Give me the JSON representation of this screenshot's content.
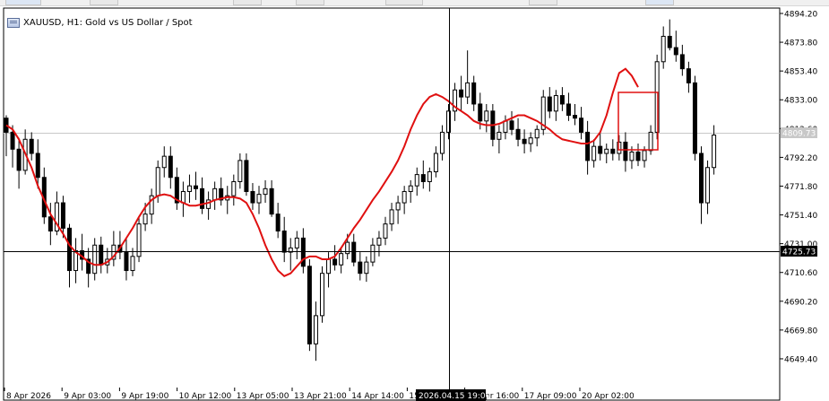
{
  "chart": {
    "symbol_title": "XAUUSD, H1:  Gold vs US Dollar / Spot",
    "bid_price_label": "4809.73",
    "crosshair_price_label": "4725.73",
    "crosshair_time_label": "2026.04.15 19:00",
    "price_axis_labels": [
      "4894.20",
      "4873.80",
      "4853.40",
      "4833.00",
      "4812.60",
      "4792.20",
      "4771.80",
      "4751.40",
      "4731.00",
      "4710.60",
      "4690.20",
      "4669.80",
      "4649.40"
    ],
    "time_axis_labels": [
      "8 Apr 2026",
      "9 Apr 03:00",
      "9 Apr 19:00",
      "10 Apr 12:00",
      "13 Apr 05:00",
      "13 Apr 21:00",
      "14 Apr 14:00",
      "15 Apr 23:00",
      "16 Apr 16:00",
      "17 Apr 09:00",
      "20 Apr 02:00"
    ],
    "colors": {
      "candle": "#000000",
      "ma": "#e01010",
      "grid": "#000000",
      "label_bg": "#000000"
    }
  },
  "chart_data": {
    "type": "candlestick",
    "symbol": "XAUUSD",
    "timeframe": "H1",
    "ylim": [
      4640,
      4900
    ],
    "candles": [
      [
        4820,
        4822,
        4793,
        4810
      ],
      [
        4810,
        4815,
        4785,
        4798
      ],
      [
        4798,
        4806,
        4770,
        4783
      ],
      [
        4783,
        4812,
        4780,
        4805
      ],
      [
        4805,
        4810,
        4790,
        4795
      ],
      [
        4795,
        4805,
        4770,
        4778
      ],
      [
        4778,
        4785,
        4745,
        4750
      ],
      [
        4750,
        4760,
        4730,
        4740
      ],
      [
        4740,
        4768,
        4737,
        4760
      ],
      [
        4760,
        4765,
        4735,
        4742
      ],
      [
        4742,
        4745,
        4700,
        4712
      ],
      [
        4712,
        4735,
        4703,
        4726
      ],
      [
        4726,
        4738,
        4712,
        4720
      ],
      [
        4720,
        4728,
        4700,
        4710
      ],
      [
        4710,
        4735,
        4705,
        4730
      ],
      [
        4730,
        4736,
        4710,
        4716
      ],
      [
        4716,
        4728,
        4710,
        4720
      ],
      [
        4720,
        4740,
        4715,
        4730
      ],
      [
        4730,
        4740,
        4720,
        4725
      ],
      [
        4725,
        4735,
        4705,
        4712
      ],
      [
        4712,
        4728,
        4708,
        4722
      ],
      [
        4722,
        4750,
        4718,
        4745
      ],
      [
        4745,
        4760,
        4740,
        4752
      ],
      [
        4752,
        4770,
        4745,
        4765
      ],
      [
        4765,
        4790,
        4760,
        4785
      ],
      [
        4785,
        4800,
        4778,
        4793
      ],
      [
        4793,
        4800,
        4770,
        4778
      ],
      [
        4778,
        4785,
        4755,
        4760
      ],
      [
        4760,
        4775,
        4750,
        4768
      ],
      [
        4768,
        4780,
        4760,
        4772
      ],
      [
        4772,
        4782,
        4762,
        4770
      ],
      [
        4770,
        4778,
        4752,
        4756
      ],
      [
        4756,
        4768,
        4748,
        4762
      ],
      [
        4762,
        4775,
        4755,
        4770
      ],
      [
        4770,
        4778,
        4758,
        4762
      ],
      [
        4762,
        4772,
        4752,
        4765
      ],
      [
        4765,
        4780,
        4758,
        4775
      ],
      [
        4775,
        4795,
        4770,
        4790
      ],
      [
        4790,
        4795,
        4765,
        4768
      ],
      [
        4768,
        4774,
        4755,
        4760
      ],
      [
        4760,
        4772,
        4752,
        4766
      ],
      [
        4766,
        4776,
        4760,
        4770
      ],
      [
        4770,
        4776,
        4750,
        4752
      ],
      [
        4752,
        4760,
        4735,
        4740
      ],
      [
        4740,
        4750,
        4718,
        4725
      ],
      [
        4725,
        4735,
        4712,
        4728
      ],
      [
        4728,
        4740,
        4720,
        4735
      ],
      [
        4735,
        4742,
        4710,
        4715
      ],
      [
        4715,
        4720,
        4655,
        4660
      ],
      [
        4660,
        4690,
        4648,
        4680
      ],
      [
        4680,
        4715,
        4675,
        4710
      ],
      [
        4710,
        4725,
        4700,
        4720
      ],
      [
        4720,
        4730,
        4712,
        4716
      ],
      [
        4716,
        4728,
        4710,
        4724
      ],
      [
        4724,
        4738,
        4720,
        4732
      ],
      [
        4732,
        4738,
        4715,
        4718
      ],
      [
        4718,
        4725,
        4705,
        4710
      ],
      [
        4710,
        4722,
        4704,
        4718
      ],
      [
        4718,
        4735,
        4715,
        4730
      ],
      [
        4730,
        4740,
        4722,
        4735
      ],
      [
        4735,
        4750,
        4730,
        4745
      ],
      [
        4745,
        4760,
        4740,
        4755
      ],
      [
        4755,
        4765,
        4745,
        4760
      ],
      [
        4760,
        4772,
        4752,
        4768
      ],
      [
        4768,
        4776,
        4760,
        4772
      ],
      [
        4772,
        4785,
        4765,
        4780
      ],
      [
        4780,
        4790,
        4770,
        4775
      ],
      [
        4775,
        4785,
        4768,
        4782
      ],
      [
        4782,
        4800,
        4778,
        4795
      ],
      [
        4795,
        4815,
        4790,
        4810
      ],
      [
        4810,
        4830,
        4805,
        4825
      ],
      [
        4825,
        4845,
        4818,
        4840
      ],
      [
        4840,
        4850,
        4825,
        4835
      ],
      [
        4835,
        4868,
        4830,
        4845
      ],
      [
        4845,
        4850,
        4825,
        4830
      ],
      [
        4830,
        4838,
        4812,
        4818
      ],
      [
        4818,
        4830,
        4810,
        4825
      ],
      [
        4825,
        4830,
        4800,
        4805
      ],
      [
        4805,
        4815,
        4795,
        4810
      ],
      [
        4810,
        4822,
        4805,
        4818
      ],
      [
        4818,
        4825,
        4808,
        4812
      ],
      [
        4812,
        4820,
        4800,
        4805
      ],
      [
        4805,
        4812,
        4795,
        4802
      ],
      [
        4802,
        4810,
        4796,
        4806
      ],
      [
        4806,
        4815,
        4800,
        4812
      ],
      [
        4812,
        4840,
        4808,
        4835
      ],
      [
        4835,
        4842,
        4820,
        4825
      ],
      [
        4825,
        4840,
        4818,
        4836
      ],
      [
        4836,
        4842,
        4825,
        4830
      ],
      [
        4830,
        4838,
        4818,
        4822
      ],
      [
        4822,
        4830,
        4815,
        4820
      ],
      [
        4820,
        4828,
        4805,
        4810
      ],
      [
        4810,
        4818,
        4780,
        4790
      ],
      [
        4790,
        4805,
        4785,
        4800
      ],
      [
        4800,
        4810,
        4790,
        4795
      ],
      [
        4795,
        4802,
        4788,
        4798
      ],
      [
        4798,
        4805,
        4790,
        4795
      ],
      [
        4795,
        4808,
        4790,
        4803
      ],
      [
        4803,
        4810,
        4782,
        4790
      ],
      [
        4790,
        4800,
        4784,
        4796
      ],
      [
        4796,
        4802,
        4786,
        4790
      ],
      [
        4790,
        4800,
        4785,
        4797
      ],
      [
        4797,
        4815,
        4794,
        4810
      ],
      [
        4810,
        4865,
        4805,
        4860
      ],
      [
        4860,
        4885,
        4855,
        4878
      ],
      [
        4878,
        4890,
        4868,
        4870
      ],
      [
        4870,
        4882,
        4860,
        4865
      ],
      [
        4865,
        4872,
        4850,
        4855
      ],
      [
        4855,
        4860,
        4838,
        4845
      ],
      [
        4845,
        4850,
        4790,
        4795
      ],
      [
        4795,
        4800,
        4745,
        4760
      ],
      [
        4760,
        4790,
        4752,
        4785
      ],
      [
        4785,
        4815,
        4780,
        4808
      ]
    ],
    "moving_average": [
      4815,
      4812,
      4805,
      4795,
      4785,
      4772,
      4762,
      4752,
      4745,
      4738,
      4730,
      4725,
      4722,
      4718,
      4716,
      4716,
      4718,
      4722,
      4728,
      4735,
      4742,
      4750,
      4757,
      4762,
      4765,
      4766,
      4765,
      4762,
      4760,
      4758,
      4758,
      4759,
      4760,
      4762,
      4763,
      4764,
      4764,
      4763,
      4760,
      4752,
      4742,
      4730,
      4720,
      4712,
      4708,
      4710,
      4715,
      4720,
      4722,
      4722,
      4720,
      4720,
      4722,
      4728,
      4735,
      4742,
      4748,
      4755,
      4762,
      4768,
      4775,
      4782,
      4790,
      4800,
      4812,
      4822,
      4830,
      4835,
      4837,
      4835,
      4832,
      4828,
      4825,
      4822,
      4818,
      4816,
      4815,
      4815,
      4816,
      4818,
      4820,
      4822,
      4822,
      4820,
      4818,
      4815,
      4812,
      4808,
      4805,
      4804,
      4803,
      4802,
      4802,
      4804,
      4810,
      4822,
      4838,
      4852,
      4855,
      4850,
      4842
    ],
    "current_price": 4809.73,
    "crosshair": {
      "price": 4725.73,
      "time": "2026.04.15 19:00"
    },
    "annotations": [
      {
        "type": "rectangle",
        "color": "#e01010"
      }
    ]
  }
}
